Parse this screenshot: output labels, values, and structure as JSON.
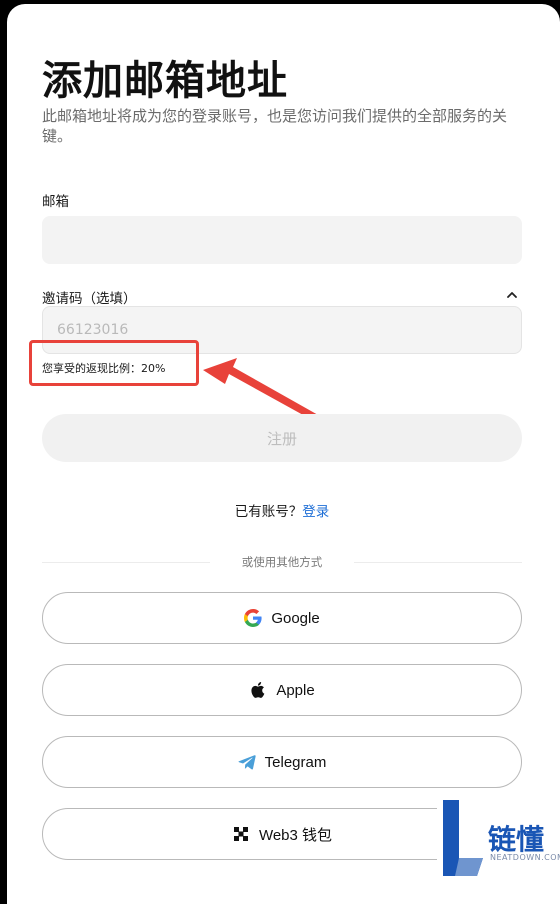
{
  "header": {
    "title": "添加邮箱地址",
    "subtitle": "此邮箱地址将成为您的登录账号，也是您访问我们提供的全部服务的关键。"
  },
  "email_field": {
    "label": "邮箱",
    "value": "",
    "placeholder": ""
  },
  "invite_field": {
    "label": "邀请码（选填）",
    "value": "",
    "placeholder": "66123016",
    "rebate_text": "您享受的返现比例：20%"
  },
  "register_button": {
    "label": "注册"
  },
  "login_prompt": {
    "text": "已有账号？",
    "link": "登录"
  },
  "divider": {
    "text": "或使用其他方式"
  },
  "social": [
    {
      "label": "Google",
      "icon": "google-icon"
    },
    {
      "label": "Apple",
      "icon": "apple-icon"
    },
    {
      "label": "Telegram",
      "icon": "telegram-icon"
    },
    {
      "label": "Web3 钱包",
      "icon": "web3-wallet-icon"
    }
  ],
  "watermark": {
    "name": "链懂",
    "sub": "NEATDOWN.COM"
  },
  "colors": {
    "accent_link": "#1f6fd6",
    "annotation_red": "#e8423a",
    "logo_blue": "#1a56b5"
  }
}
